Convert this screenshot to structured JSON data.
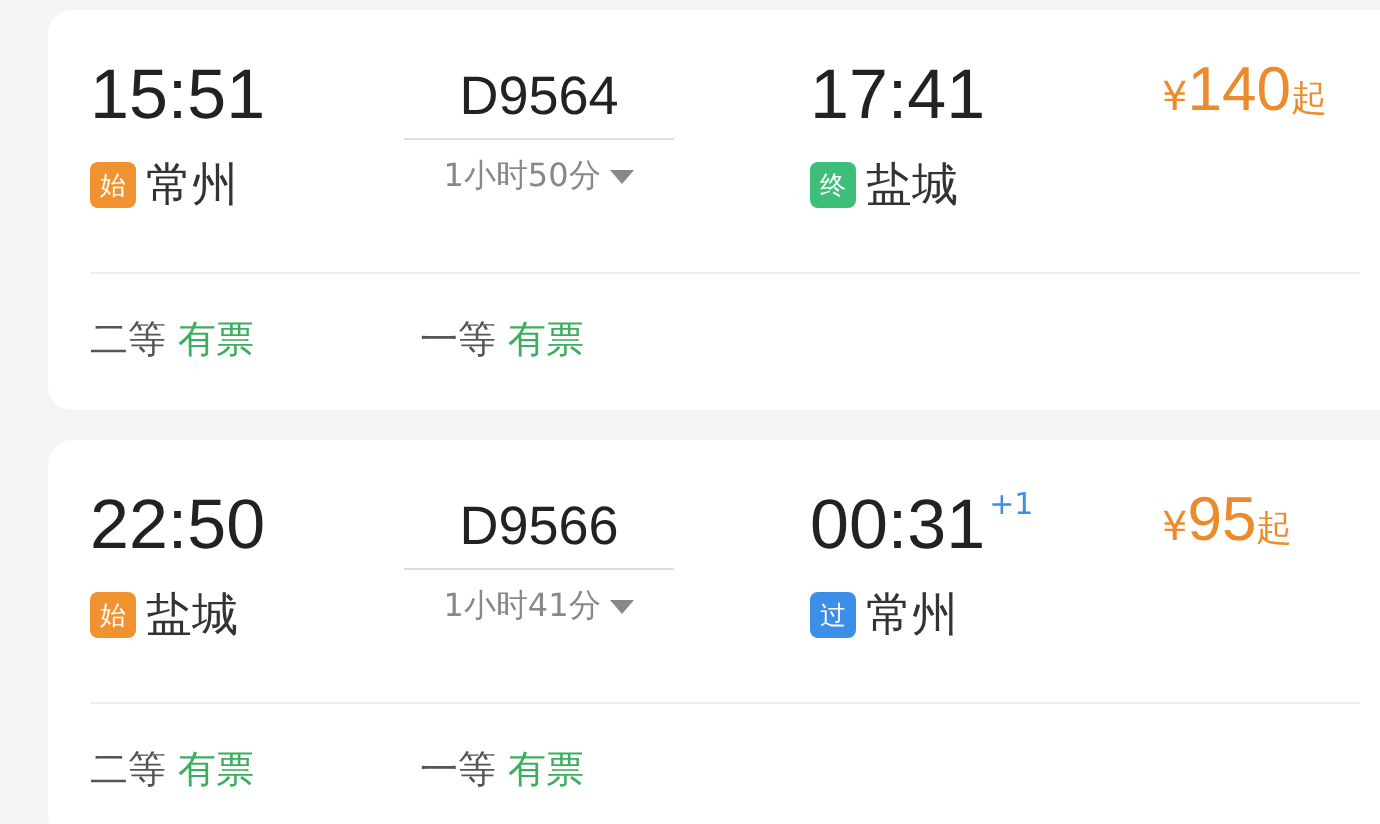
{
  "trains": [
    {
      "depart_time": "15:51",
      "depart_station": {
        "kind": "start",
        "tag": "始",
        "name": "常州"
      },
      "number": "D9564",
      "duration": "1小时50分",
      "arrive_time": "17:41",
      "arrive_station": {
        "kind": "end",
        "tag": "终",
        "name": "盐城"
      },
      "price": {
        "currency": "¥",
        "amount": "140",
        "suffix": "起"
      },
      "seats": [
        {
          "class": "二等",
          "status": "有票"
        },
        {
          "class": "一等",
          "status": "有票"
        }
      ]
    },
    {
      "depart_time": "22:50",
      "depart_station": {
        "kind": "start",
        "tag": "始",
        "name": "盐城"
      },
      "number": "D9566",
      "duration": "1小时41分",
      "arrive_time": "00:31",
      "day_offset": "+1",
      "arrive_station": {
        "kind": "pass",
        "tag": "过",
        "name": "常州"
      },
      "price": {
        "currency": "¥",
        "amount": "95",
        "suffix": "起"
      },
      "seats": [
        {
          "class": "二等",
          "status": "有票"
        },
        {
          "class": "一等",
          "status": "有票"
        }
      ]
    }
  ]
}
